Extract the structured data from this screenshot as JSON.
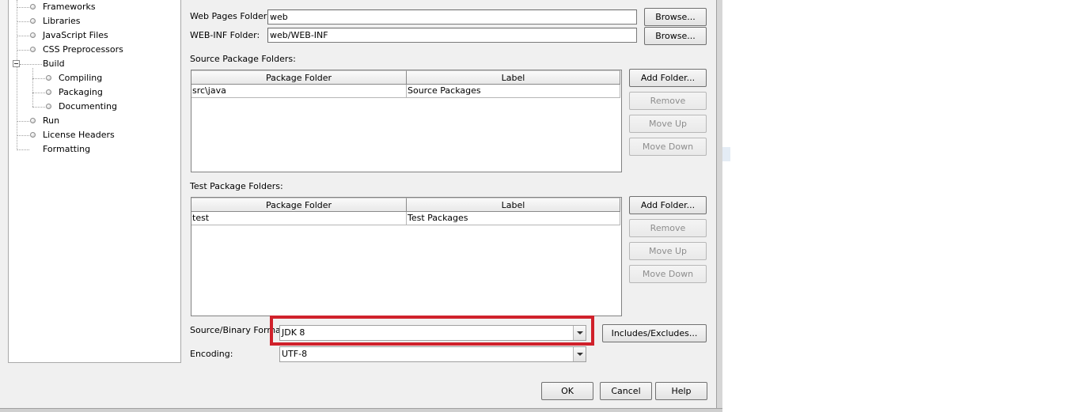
{
  "tree": {
    "items": [
      {
        "label": "Frameworks"
      },
      {
        "label": "Libraries"
      },
      {
        "label": "JavaScript Files"
      },
      {
        "label": "CSS Preprocessors"
      },
      {
        "label": "Build"
      },
      {
        "label": "Compiling"
      },
      {
        "label": "Packaging"
      },
      {
        "label": "Documenting"
      },
      {
        "label": "Run"
      },
      {
        "label": "License Headers"
      },
      {
        "label": "Formatting"
      }
    ]
  },
  "folders": {
    "web_pages_label": "Web Pages Folder:",
    "web_pages_value": "web",
    "web_inf_label": "WEB-INF Folder:",
    "web_inf_value": "web/WEB-INF",
    "browse_label": "Browse..."
  },
  "source_packages": {
    "title": "Source Package Folders:",
    "columns": [
      "Package Folder",
      "Label"
    ],
    "rows": [
      [
        "src\\java",
        "Source Packages"
      ]
    ]
  },
  "test_packages": {
    "title": "Test Package Folders:",
    "columns": [
      "Package Folder",
      "Label"
    ],
    "rows": [
      [
        "test",
        "Test Packages"
      ]
    ]
  },
  "side_buttons": {
    "add_folder": "Add Folder...",
    "remove": "Remove",
    "move_up": "Move Up",
    "move_down": "Move Down"
  },
  "format": {
    "source_binary_label": "Source/Binary Format:",
    "source_binary_value": "JDK 8",
    "encoding_label": "Encoding:",
    "encoding_value": "UTF-8",
    "includes_excludes": "Includes/Excludes..."
  },
  "dialog_buttons": {
    "ok": "OK",
    "cancel": "Cancel",
    "help": "Help"
  },
  "colors": {
    "highlight": "#d0212b"
  }
}
